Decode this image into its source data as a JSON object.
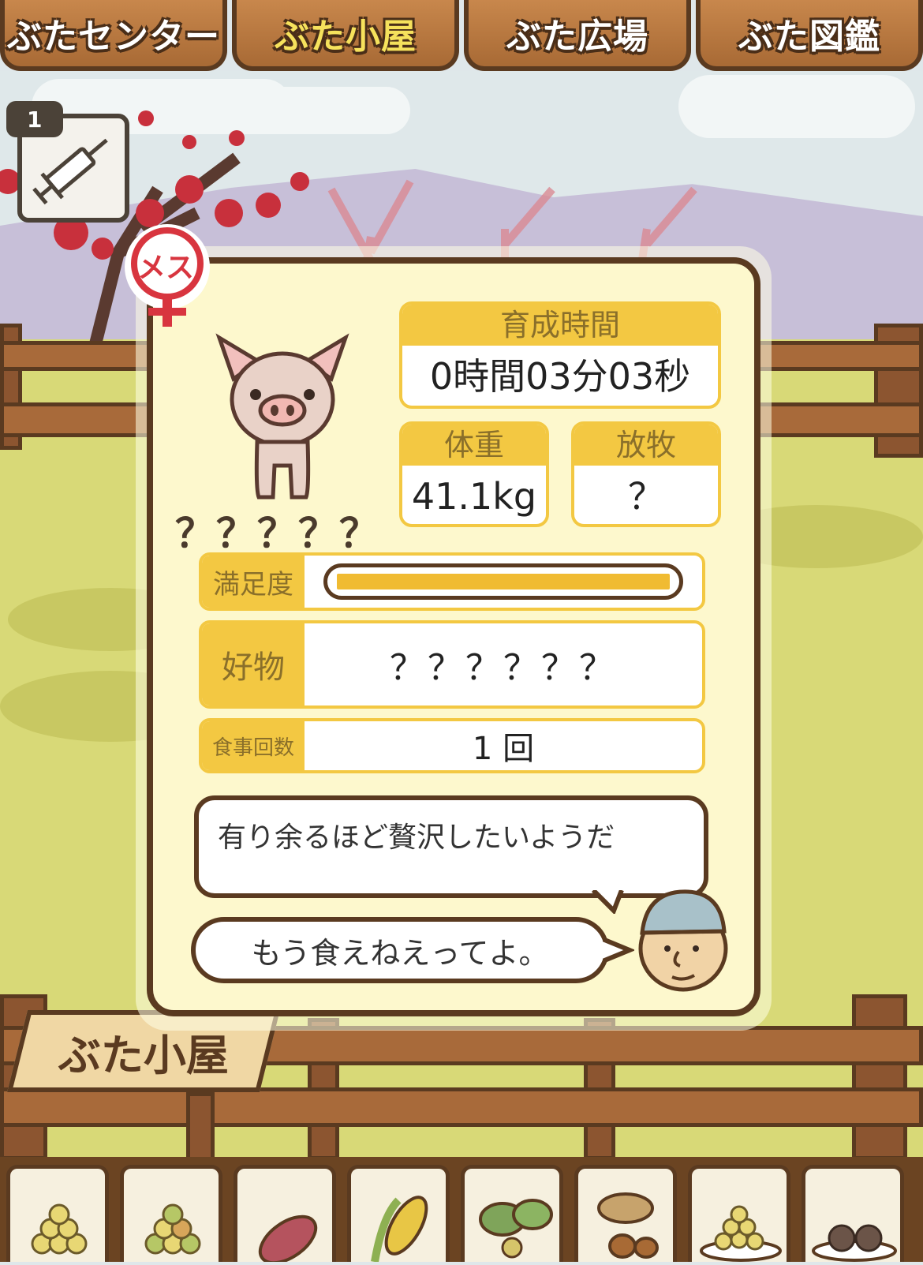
{
  "tabs": [
    {
      "label": "ぶたセンター",
      "active": false
    },
    {
      "label": "ぶた小屋",
      "active": true
    },
    {
      "label": "ぶた広場",
      "active": false
    },
    {
      "label": "ぶた図鑑",
      "active": false
    }
  ],
  "item": {
    "count": "1",
    "icon": "syringe-icon"
  },
  "gender_badge": {
    "label": "メス",
    "icon": "female-symbol-icon"
  },
  "pig": {
    "name": "？？？？？",
    "icon": "pig-icon"
  },
  "stats": {
    "time_label": "育成時間",
    "time_value": "0時間03分03秒",
    "weight_label": "体重",
    "weight_value": "41.1kg",
    "grazing_label": "放牧",
    "grazing_value": "？"
  },
  "satisfaction": {
    "label": "満足度",
    "level": 1.0
  },
  "favorite": {
    "label": "好物",
    "value": "？？？？？？"
  },
  "meals": {
    "label": "食事回数",
    "value": "1 回"
  },
  "messages": {
    "description": "有り余るほど贅沢したいようだ",
    "farmer_speech": "もう食えねえってよ。"
  },
  "sign": {
    "label": "ぶた小屋"
  },
  "food_items": [
    "grain-pile-icon",
    "mixed-grain-icon",
    "sweet-potato-icon",
    "corn-icon",
    "leafy-vegetables-icon",
    "acorns-icon",
    "pellet-bowl-icon",
    "dumplings-plate-icon"
  ],
  "colors": {
    "accent": "#f3c842",
    "frame": "#5a3a20",
    "card": "#fdf8cd",
    "female_red": "#d8353f"
  }
}
